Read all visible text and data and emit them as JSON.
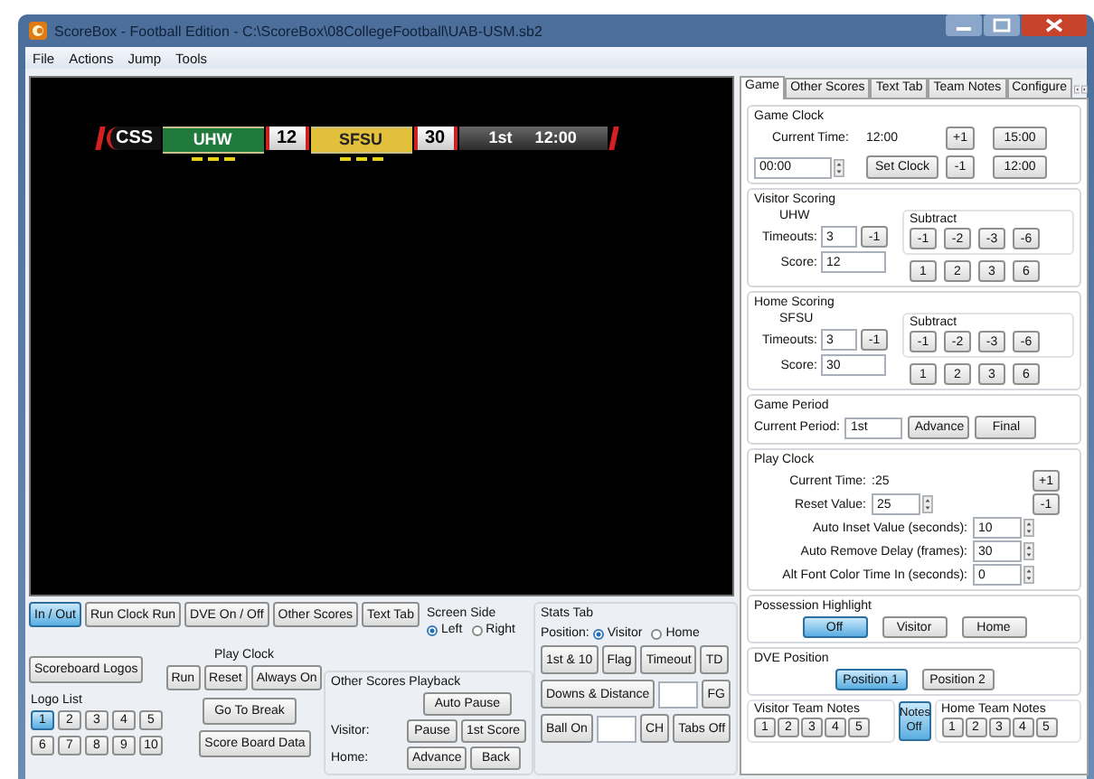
{
  "window": {
    "title": "ScoreBox - Football Edition - C:\\ScoreBox\\08CollegeFootball\\UAB-USM.sb2"
  },
  "menu": [
    {
      "label": "File"
    },
    {
      "label": "Actions"
    },
    {
      "label": "Jump"
    },
    {
      "label": "Tools"
    }
  ],
  "scorebug": {
    "logo": "CSS",
    "period": "1st",
    "clock": "12:00",
    "teams": [
      {
        "name": "UHW",
        "score": "12",
        "color": "#1f7a3c"
      },
      {
        "name": "SFSU",
        "score": "30",
        "color": "#e2c03c"
      }
    ]
  },
  "controls": {
    "top_buttons": [
      {
        "label": "In / Out",
        "selected": true
      },
      {
        "label": "Run Clock Run",
        "selected": false
      },
      {
        "label": "DVE On / Off",
        "selected": false
      },
      {
        "label": "Other Scores",
        "selected": false
      },
      {
        "label": "Text Tab",
        "selected": false
      }
    ],
    "screen_side": {
      "title": "Screen Side",
      "options": [
        {
          "label": "Left",
          "selected": true
        },
        {
          "label": "Right",
          "selected": false
        }
      ]
    },
    "scoreboard_logos": "Scoreboard Logos",
    "play_clock": {
      "title": "Play Clock",
      "buttons": [
        {
          "label": "Run"
        },
        {
          "label": "Reset"
        },
        {
          "label": "Always On"
        }
      ]
    },
    "logo_list": {
      "title": "Logo List",
      "items": [
        {
          "label": "1",
          "selected": true
        },
        {
          "label": "2",
          "selected": false
        },
        {
          "label": "3",
          "selected": false
        },
        {
          "label": "4",
          "selected": false
        },
        {
          "label": "5",
          "selected": false
        },
        {
          "label": "6",
          "selected": false
        },
        {
          "label": "7",
          "selected": false
        },
        {
          "label": "8",
          "selected": false
        },
        {
          "label": "9",
          "selected": false
        },
        {
          "label": "10",
          "selected": false
        }
      ]
    },
    "go_to_break": "Go To Break",
    "score_board_data": "Score Board Data",
    "other_scores_playback": {
      "title": "Other Scores Playback",
      "auto_pause": "Auto Pause",
      "rows": [
        {
          "label": "Visitor:",
          "buttons": [
            {
              "label": "Pause"
            },
            {
              "label": "1st Score"
            }
          ]
        },
        {
          "label": "Home:",
          "buttons": [
            {
              "label": "Advance"
            },
            {
              "label": "Back"
            }
          ]
        }
      ]
    }
  },
  "stats_tab": {
    "title": "Stats Tab",
    "position_label": "Position:",
    "options": [
      {
        "label": "Visitor",
        "selected": true
      },
      {
        "label": "Home",
        "selected": false
      }
    ],
    "row1": [
      {
        "label": "1st & 10"
      },
      {
        "label": "Flag"
      },
      {
        "label": "Timeout"
      },
      {
        "label": "TD"
      }
    ],
    "downs": "Downs & Distance",
    "fg": "FG",
    "ball_on": "Ball On",
    "ch": "CH",
    "tabs_off": "Tabs Off"
  },
  "panel": {
    "tabs": [
      {
        "label": "Game",
        "selected": true
      },
      {
        "label": "Other Scores",
        "selected": false
      },
      {
        "label": "Text Tab",
        "selected": false
      },
      {
        "label": "Team Notes",
        "selected": false
      },
      {
        "label": "Configure",
        "selected": false
      }
    ],
    "game_clock": {
      "title": "Game Clock",
      "current_label": "Current Time:",
      "current": "12:00",
      "plus": "+1",
      "preset1": "15:00",
      "field": "00:00",
      "set": "Set Clock",
      "minus": "-1",
      "preset2": "12:00"
    },
    "teams": [
      {
        "title": "Visitor Scoring",
        "name": "UHW",
        "timeouts_label": "Timeouts:",
        "timeouts": "3",
        "timeout_button": "-1",
        "score_label": "Score:",
        "score": "12",
        "subtract_title": "Subtract",
        "subtract": [
          "-1",
          "-2",
          "-3",
          "-6"
        ],
        "add": [
          "1",
          "2",
          "3",
          "6"
        ]
      },
      {
        "title": "Home Scoring",
        "name": "SFSU",
        "timeouts_label": "Timeouts:",
        "timeouts": "3",
        "timeout_button": "-1",
        "score_label": "Score:",
        "score": "30",
        "subtract_title": "Subtract",
        "subtract": [
          "-1",
          "-2",
          "-3",
          "-6"
        ],
        "add": [
          "1",
          "2",
          "3",
          "6"
        ]
      }
    ],
    "game_period": {
      "title": "Game Period",
      "label": "Current Period:",
      "value": "1st",
      "advance": "Advance",
      "final": "Final"
    },
    "play_clock": {
      "title": "Play Clock",
      "current_label": "Current Time:",
      "current": ":25",
      "plus": "+1",
      "reset_label": "Reset Value:",
      "reset": "25",
      "minus": "-1",
      "settings": [
        {
          "label": "Auto Inset Value (seconds):",
          "value": "10"
        },
        {
          "label": "Auto Remove Delay (frames):",
          "value": "30"
        },
        {
          "label": "Alt Font Color Time In (seconds):",
          "value": "0"
        }
      ]
    },
    "possession": {
      "title": "Possession Highlight",
      "options": [
        {
          "label": "Off",
          "selected": true
        },
        {
          "label": "Visitor",
          "selected": false
        },
        {
          "label": "Home",
          "selected": false
        }
      ]
    },
    "dve": {
      "title": "DVE Position",
      "options": [
        {
          "label": "Position 1",
          "selected": true
        },
        {
          "label": "Position 2",
          "selected": false
        }
      ]
    },
    "notes": {
      "visitor_title": "Visitor Team Notes",
      "visitor": [
        {
          "label": "1"
        },
        {
          "label": "2"
        },
        {
          "label": "3"
        },
        {
          "label": "4"
        },
        {
          "label": "5"
        }
      ],
      "toggle": {
        "label": "Notes Off",
        "selected": true
      },
      "home_title": "Home Team Notes",
      "home": [
        {
          "label": "1"
        },
        {
          "label": "2"
        },
        {
          "label": "3"
        },
        {
          "label": "4"
        },
        {
          "label": "5"
        }
      ]
    }
  }
}
